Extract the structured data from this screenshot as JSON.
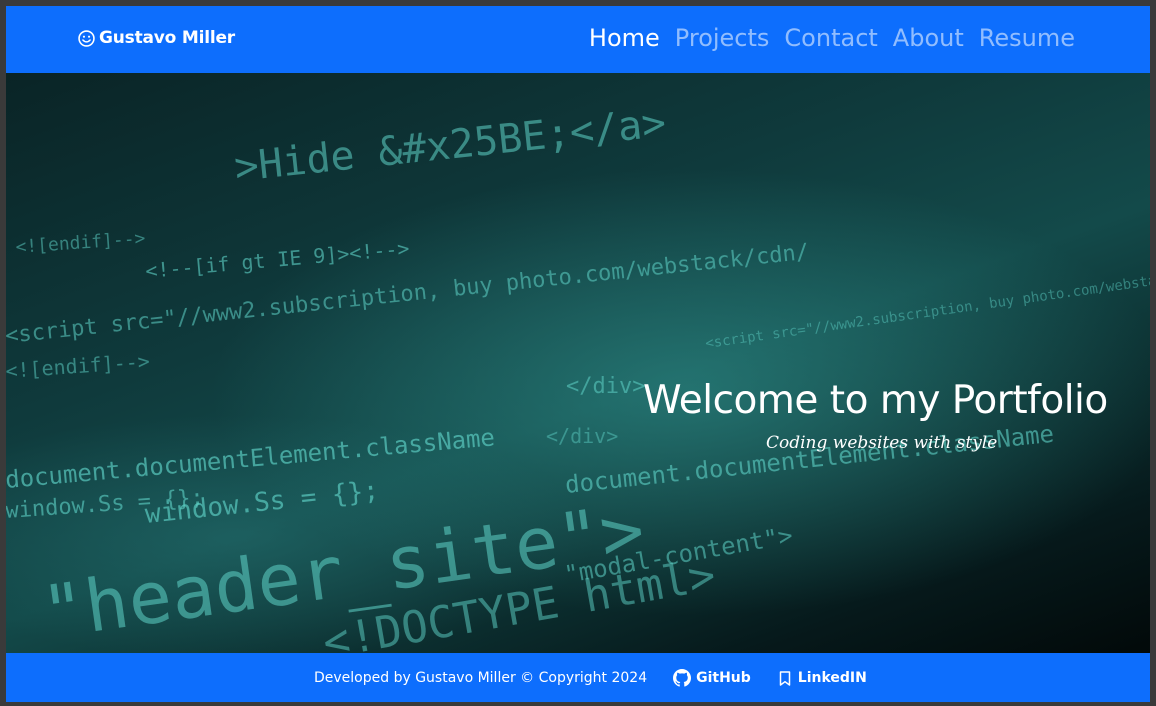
{
  "navbar": {
    "brand_icon": "smiley-icon",
    "brand": "Gustavo Miller",
    "links": [
      "Home",
      "Projects",
      "Contact",
      "About",
      "Resume"
    ],
    "active": "Home"
  },
  "hero": {
    "background": "code-photo",
    "title": "Welcome to my Portfolio",
    "subtitle": "Coding websites with style",
    "code_fragments": [
      "\"header_site\">",
      "<!DOCTYPE html>",
      ">Hide &#x25BE;</a>",
      "<script src=\"//www2.subscription, buy photo.com/webstack/cdn/",
      "window.Ss = {};",
      "document.documentElement.className",
      "<!--[if gt IE 9]><!-->",
      "<![endif]-->",
      "</div>",
      "\"modal-content\">"
    ]
  },
  "footer": {
    "copyright": "Developed by Gustavo Miller © Copyright 2024",
    "github": "GitHub",
    "github_icon": "github-icon",
    "linkedin": "LinkedIN",
    "linkedin_icon": "bookmark-icon"
  },
  "colors": {
    "primary": "#0d6efd",
    "nav_inactive": "rgba(255,255,255,0.55)",
    "code_teal": "#5fd3c8"
  }
}
